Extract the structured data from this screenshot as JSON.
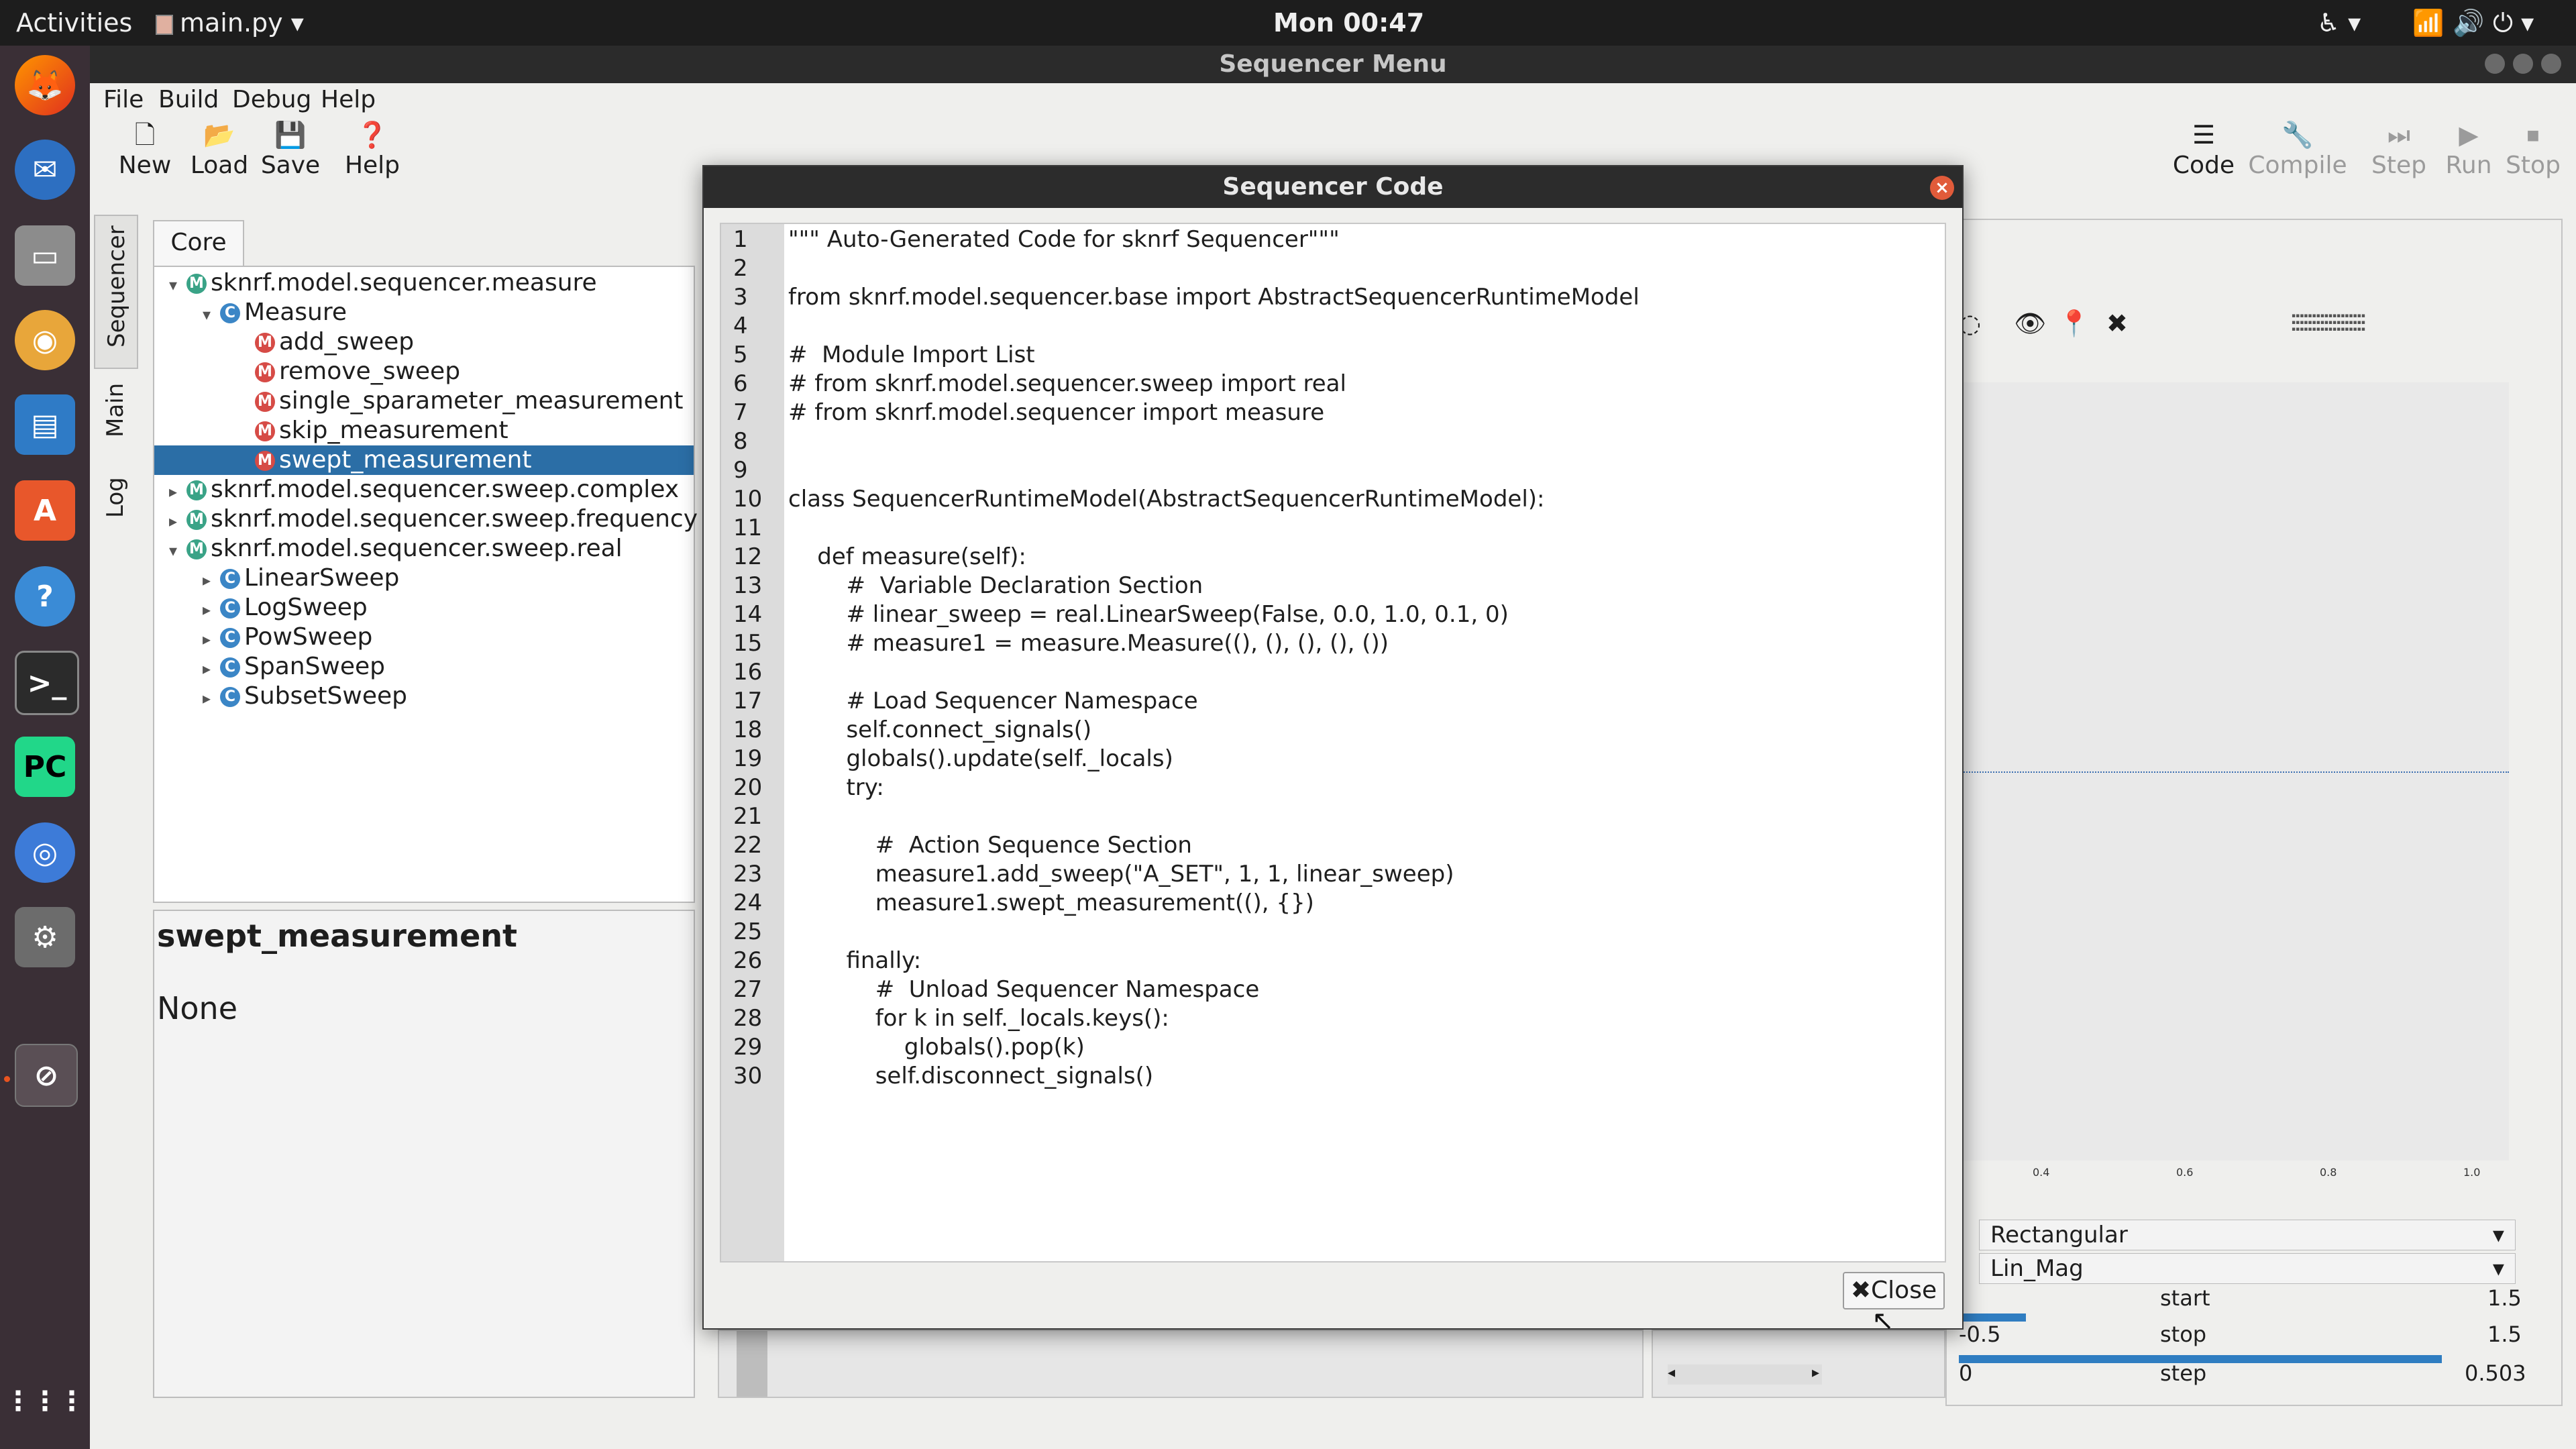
{
  "topbar": {
    "activities": "Activities",
    "app_menu": "main.py",
    "clock": "Mon 00:47"
  },
  "window": {
    "title": "Sequencer Menu"
  },
  "menubar": [
    "File",
    "Build",
    "Debug",
    "Help"
  ],
  "toolbar_left": [
    {
      "label": "New",
      "icon": "new-icon"
    },
    {
      "label": "Load",
      "icon": "folder-icon"
    },
    {
      "label": "Save",
      "icon": "save-icon"
    },
    {
      "label": "Help",
      "icon": "help-icon"
    }
  ],
  "toolbar_right": [
    {
      "label": "Code",
      "icon": "code-icon",
      "enabled": true
    },
    {
      "label": "Compile",
      "icon": "wrench-icon",
      "enabled": false
    },
    {
      "label": "Step",
      "icon": "step-icon",
      "enabled": false
    },
    {
      "label": "Run",
      "icon": "play-icon",
      "enabled": false
    },
    {
      "label": "Stop",
      "icon": "stop-icon",
      "enabled": false
    }
  ],
  "side_tabs": [
    "Sequencer",
    "Main",
    "Log"
  ],
  "tree": {
    "tab": "Core",
    "items": [
      {
        "label": "sknrf.model.sequencer.measure",
        "badge": "M",
        "kind": "module",
        "expanded": true,
        "level": 0
      },
      {
        "label": "Measure",
        "badge": "C",
        "kind": "class",
        "expanded": true,
        "level": 1
      },
      {
        "label": "add_sweep",
        "badge": "M",
        "kind": "method",
        "level": 2
      },
      {
        "label": "remove_sweep",
        "badge": "M",
        "kind": "method",
        "level": 2
      },
      {
        "label": "single_sparameter_measurement",
        "badge": "M",
        "kind": "method",
        "level": 2
      },
      {
        "label": "skip_measurement",
        "badge": "M",
        "kind": "method",
        "level": 2
      },
      {
        "label": "swept_measurement",
        "badge": "M",
        "kind": "method",
        "level": 2,
        "selected": true
      },
      {
        "label": "sknrf.model.sequencer.sweep.complex",
        "badge": "M",
        "kind": "module",
        "expanded": false,
        "level": 0
      },
      {
        "label": "sknrf.model.sequencer.sweep.frequency",
        "badge": "M",
        "kind": "module",
        "expanded": false,
        "level": 0
      },
      {
        "label": "sknrf.model.sequencer.sweep.real",
        "badge": "M",
        "kind": "module",
        "expanded": true,
        "level": 0
      },
      {
        "label": "LinearSweep",
        "badge": "C",
        "kind": "class",
        "expanded": false,
        "level": 1
      },
      {
        "label": "LogSweep",
        "badge": "C",
        "kind": "class",
        "expanded": false,
        "level": 1
      },
      {
        "label": "PowSweep",
        "badge": "C",
        "kind": "class",
        "expanded": false,
        "level": 1
      },
      {
        "label": "SpanSweep",
        "badge": "C",
        "kind": "class",
        "expanded": false,
        "level": 1
      },
      {
        "label": "SubsetSweep",
        "badge": "C",
        "kind": "class",
        "expanded": false,
        "level": 1
      }
    ]
  },
  "description": {
    "title": "swept_measurement",
    "body": "None"
  },
  "background": {
    "dropdown1": "Rectangular",
    "dropdown2": "Lin_Mag",
    "fields": [
      {
        "label": "start",
        "value": "1.5"
      },
      {
        "label": "stop",
        "value": "1.5"
      },
      {
        "label": "step",
        "value": "0.503"
      }
    ],
    "axis_ticks": [
      "0.4",
      "0.6",
      "0.8",
      "1.0"
    ],
    "slider_left": "0",
    "slider_partial": "-0.5"
  },
  "dialog": {
    "title": "Sequencer Code",
    "close_label": "Close",
    "code_lines": [
      "\"\"\" Auto-Generated Code for sknrf Sequencer\"\"\"",
      "",
      "from sknrf.model.sequencer.base import AbstractSequencerRuntimeModel",
      "",
      "#  Module Import List",
      "# from sknrf.model.sequencer.sweep import real",
      "# from sknrf.model.sequencer import measure",
      "",
      "",
      "class SequencerRuntimeModel(AbstractSequencerRuntimeModel):",
      "",
      "    def measure(self):",
      "        #  Variable Declaration Section",
      "        # linear_sweep = real.LinearSweep(False, 0.0, 1.0, 0.1, 0)",
      "        # measure1 = measure.Measure((), (), (), (), ())",
      "",
      "        # Load Sequencer Namespace",
      "        self.connect_signals()",
      "        globals().update(self._locals)",
      "        try:",
      "",
      "            #  Action Sequence Section",
      "            measure1.add_sweep(\"A_SET\", 1, 1, linear_sweep)",
      "            measure1.swept_measurement((), {})",
      "",
      "        finally:",
      "            #  Unload Sequencer Namespace",
      "            for k in self._locals.keys():",
      "                globals().pop(k)",
      "            self.disconnect_signals()"
    ]
  }
}
